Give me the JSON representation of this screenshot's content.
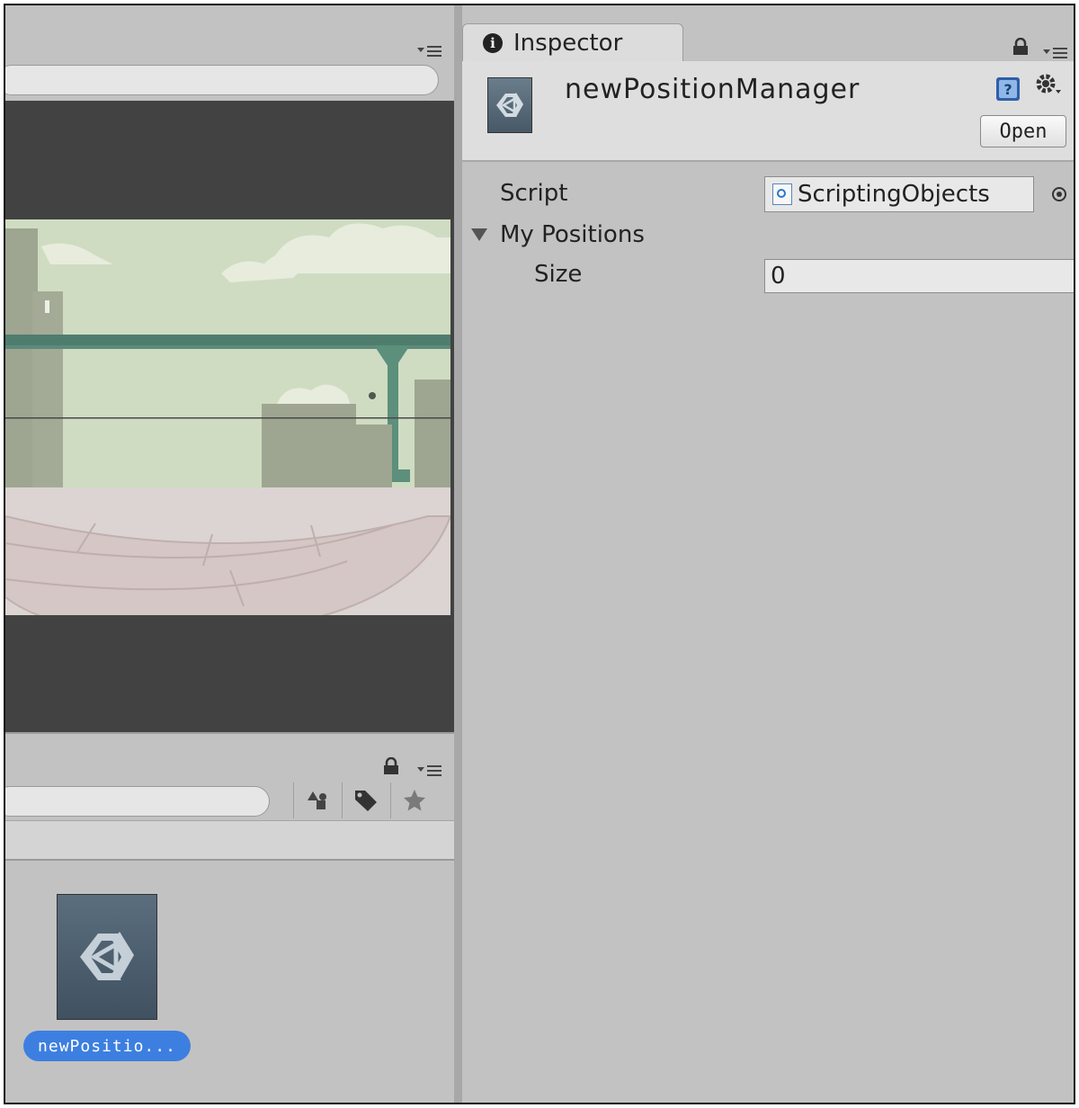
{
  "scene_panel": {
    "menu_icon": "dropdown-menu-icon"
  },
  "project_panel": {
    "lock_icon": "lock-icon",
    "menu_icon": "dropdown-menu-icon",
    "toolbar_icons": [
      "filter-by-type-icon",
      "filter-by-label-icon",
      "favorite-star-icon"
    ],
    "asset": {
      "icon": "unity-logo-icon",
      "label": "newPositio..."
    }
  },
  "inspector": {
    "tab_label": "Inspector",
    "tab_icon": "info-icon",
    "object_name": "newPositionManager",
    "open_label": "Open",
    "properties": {
      "script_label": "Script",
      "script_value": "ScriptingObjects",
      "my_positions_label": "My Positions",
      "size_label": "Size",
      "size_value": "0"
    }
  },
  "colors": {
    "selection": "#3d7fe0",
    "panel_bg": "#c2c2c2",
    "scene_bg": "#424242"
  }
}
